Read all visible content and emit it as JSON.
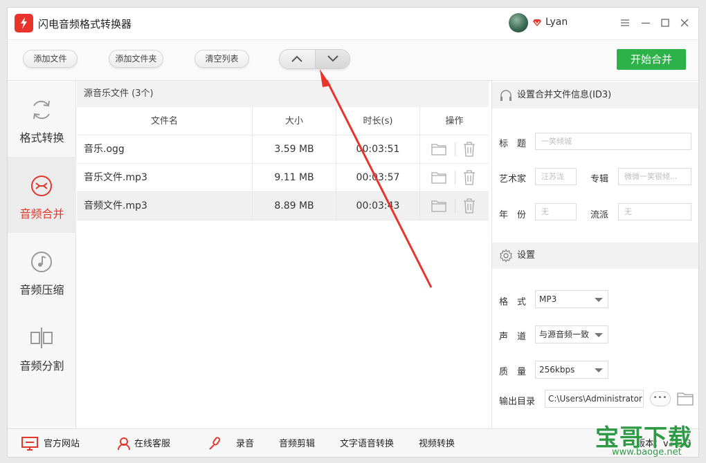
{
  "app": {
    "title": "闪电音频格式转换器",
    "username": "Lyan",
    "accent_color": "#e3362b",
    "brand_color": "#2db24a"
  },
  "window_controls": [
    "menu-icon",
    "minimize-icon",
    "maximize-icon",
    "close-icon"
  ],
  "toolbar": {
    "add_file": "添加文件",
    "add_folder": "添加文件夹",
    "clear_list": "清空列表",
    "move_up_icon": "chevron-up-icon",
    "move_down_icon": "chevron-down-icon",
    "start_merge": "开始合并"
  },
  "sidebar": {
    "items": [
      {
        "label": "格式转换",
        "icon": "refresh-icon",
        "active": false
      },
      {
        "label": "音频合并",
        "icon": "merge-icon",
        "active": true
      },
      {
        "label": "音频压缩",
        "icon": "music-note-icon",
        "active": false
      },
      {
        "label": "音频分割",
        "icon": "split-icon",
        "active": false
      }
    ]
  },
  "file_list": {
    "header": "源音乐文件 (3个)",
    "columns": {
      "name": "文件名",
      "size": "大小",
      "duration": "时长(s)",
      "ops": "操作"
    },
    "rows": [
      {
        "name": "音乐.ogg",
        "size": "3.59 MB",
        "duration": "00:03:51"
      },
      {
        "name": "音乐文件.mp3",
        "size": "9.11 MB",
        "duration": "00:03:57"
      },
      {
        "name": "音频文件.mp3",
        "size": "8.89 MB",
        "duration": "00:03:43"
      }
    ]
  },
  "id3": {
    "header": "设置合并文件信息(ID3)",
    "title_label": "标　题",
    "title_value": "一笑倾城",
    "artist_label": "艺术家",
    "artist_value": "汪苏泷",
    "album_label": "专辑",
    "album_value": "微微一笑很倾...",
    "year_label": "年　份",
    "year_value": "无",
    "genre_label": "流派",
    "genre_value": "无"
  },
  "settings": {
    "header": "设置",
    "format_label": "格　式",
    "format_value": "MP3",
    "channel_label": "声　道",
    "channel_value": "与源音频一致",
    "quality_label": "质　量",
    "quality_value": "256kbps",
    "output_label": "输出目录",
    "output_value": "C:\\Users\\Administrator",
    "more_label": "•••"
  },
  "bottom": {
    "website": "官方网站",
    "support": "在线客服",
    "record": "录音",
    "audio_edit": "音频剪辑",
    "tts": "文字语音转换",
    "video_convert": "视频转换",
    "version": "版本：v3.2.3"
  },
  "watermark": {
    "brand": "宝哥下载",
    "url": "www.baoge.net"
  }
}
